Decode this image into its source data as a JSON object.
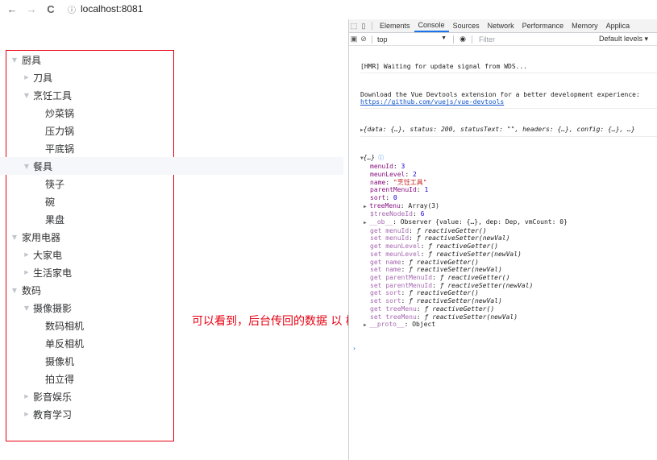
{
  "browser": {
    "back_icon": "←",
    "forward_icon": "→",
    "reload_icon": "C",
    "info_icon": "ⓘ",
    "url": "localhost:8081"
  },
  "tree": [
    {
      "label": "厨具",
      "level": 0,
      "expanded": true,
      "has_children": true
    },
    {
      "label": "刀具",
      "level": 1,
      "expanded": false,
      "has_children": true
    },
    {
      "label": "烹饪工具",
      "level": 1,
      "expanded": true,
      "has_children": true
    },
    {
      "label": "炒菜锅",
      "level": 2,
      "has_children": false
    },
    {
      "label": "压力锅",
      "level": 2,
      "has_children": false
    },
    {
      "label": "平底锅",
      "level": 2,
      "has_children": false
    },
    {
      "label": "餐具",
      "level": 1,
      "expanded": true,
      "has_children": true,
      "active": true
    },
    {
      "label": "筷子",
      "level": 2,
      "has_children": false
    },
    {
      "label": "碗",
      "level": 2,
      "has_children": false
    },
    {
      "label": "果盘",
      "level": 2,
      "has_children": false
    },
    {
      "label": "家用电器",
      "level": 0,
      "expanded": true,
      "has_children": true
    },
    {
      "label": "大家电",
      "level": 1,
      "expanded": false,
      "has_children": true
    },
    {
      "label": "生活家电",
      "level": 1,
      "expanded": false,
      "has_children": true
    },
    {
      "label": "数码",
      "level": 0,
      "expanded": true,
      "has_children": true
    },
    {
      "label": "摄像摄影",
      "level": 1,
      "expanded": true,
      "has_children": true
    },
    {
      "label": "数码相机",
      "level": 2,
      "has_children": false
    },
    {
      "label": "单反相机",
      "level": 2,
      "has_children": false
    },
    {
      "label": "摄像机",
      "level": 2,
      "has_children": false
    },
    {
      "label": "拍立得",
      "level": 2,
      "has_children": false
    },
    {
      "label": "影音娱乐",
      "level": 1,
      "expanded": false,
      "has_children": true
    },
    {
      "label": "教育学习",
      "level": 1,
      "expanded": false,
      "has_children": true
    }
  ],
  "annotation": "可以看到，后台传回的数据 以 树形的方式展开",
  "devtools": {
    "tabs": [
      "Elements",
      "Console",
      "Sources",
      "Network",
      "Performance",
      "Memory",
      "Applica"
    ],
    "selected_tab": "Console",
    "context": "top",
    "filter_placeholder": "Filter",
    "levels": "Default levels ▾",
    "messages": {
      "hmr": "[HMR] Waiting for update signal from WDS...",
      "vue_line1": "Download the Vue Devtools extension for a better development experience:",
      "vue_link": "https://github.com/vuejs/vue-devtools",
      "response": "{data: {…}, status: 200, statusText: \"\", headers: {…}, config: {…}, …}"
    },
    "object": {
      "header": "{…}",
      "props": [
        {
          "key": "menuId",
          "value": "3",
          "type": "num"
        },
        {
          "key": "meunLevel",
          "value": "2",
          "type": "num"
        },
        {
          "key": "name",
          "value": "\"烹饪工具\"",
          "type": "str"
        },
        {
          "key": "parentMenuId",
          "value": "1",
          "type": "num"
        },
        {
          "key": "sort",
          "value": "0",
          "type": "num"
        },
        {
          "key": "treeMenu",
          "value": "Array(3)",
          "type": "plain",
          "expandable": true
        },
        {
          "key": "$treeNodeId",
          "value": "6",
          "type": "num",
          "faint": true
        },
        {
          "key": "__ob__",
          "value": "Observer {value: {…}, dep: Dep, vmCount: 0}",
          "type": "plain",
          "expandable": true,
          "faint": true
        },
        {
          "key": "get menuId",
          "value": "ƒ reactiveGetter()",
          "type": "fn",
          "faint": true
        },
        {
          "key": "set menuId",
          "value": "ƒ reactiveSetter(newVal)",
          "type": "fn",
          "faint": true
        },
        {
          "key": "get meunLevel",
          "value": "ƒ reactiveGetter()",
          "type": "fn",
          "faint": true
        },
        {
          "key": "set meunLevel",
          "value": "ƒ reactiveSetter(newVal)",
          "type": "fn",
          "faint": true
        },
        {
          "key": "get name",
          "value": "ƒ reactiveGetter()",
          "type": "fn",
          "faint": true
        },
        {
          "key": "set name",
          "value": "ƒ reactiveSetter(newVal)",
          "type": "fn",
          "faint": true
        },
        {
          "key": "get parentMenuId",
          "value": "ƒ reactiveGetter()",
          "type": "fn",
          "faint": true
        },
        {
          "key": "set parentMenuId",
          "value": "ƒ reactiveSetter(newVal)",
          "type": "fn",
          "faint": true
        },
        {
          "key": "get sort",
          "value": "ƒ reactiveGetter()",
          "type": "fn",
          "faint": true
        },
        {
          "key": "set sort",
          "value": "ƒ reactiveSetter(newVal)",
          "type": "fn",
          "faint": true
        },
        {
          "key": "get treeMenu",
          "value": "ƒ reactiveGetter()",
          "type": "fn",
          "faint": true
        },
        {
          "key": "set treeMenu",
          "value": "ƒ reactiveSetter(newVal)",
          "type": "fn",
          "faint": true
        },
        {
          "key": "__proto__",
          "value": "Object",
          "type": "plain",
          "expandable": true,
          "faint": true
        }
      ]
    },
    "prompt": "›"
  },
  "colors": {
    "accent_red": "#e60012",
    "devtools_blue": "#1a73e8"
  }
}
